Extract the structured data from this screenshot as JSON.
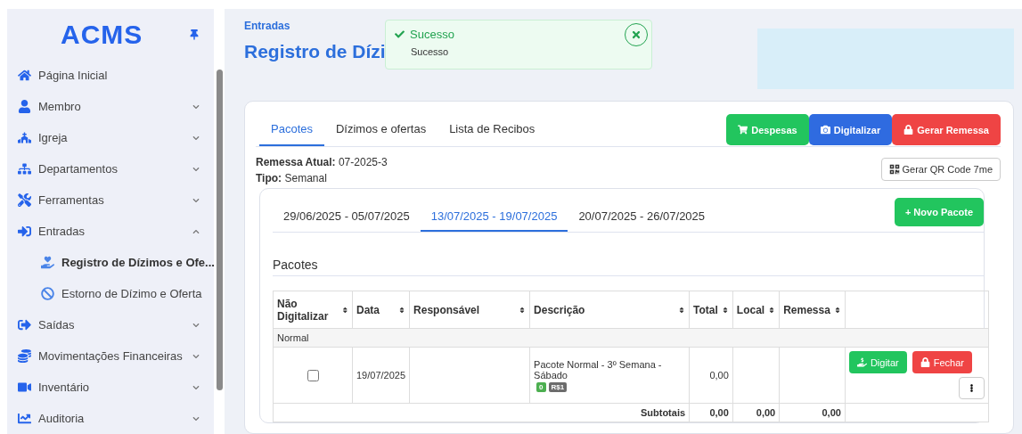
{
  "sidebar": {
    "logo": "ACMS",
    "items": [
      {
        "label": "Página Inicial"
      },
      {
        "label": "Membro",
        "expanded": false
      },
      {
        "label": "Igreja",
        "expanded": false
      },
      {
        "label": "Departamentos",
        "expanded": false
      },
      {
        "label": "Ferramentas",
        "expanded": false
      },
      {
        "label": "Entradas",
        "expanded": true,
        "children": [
          {
            "label": "Registro de Dízimos e Ofe...",
            "selected": true
          },
          {
            "label": "Estorno de Dízimo e Oferta",
            "selected": false
          }
        ]
      },
      {
        "label": "Saídas",
        "expanded": false
      },
      {
        "label": "Movimentações Financeiras",
        "expanded": false
      },
      {
        "label": "Inventário",
        "expanded": false
      },
      {
        "label": "Auditoria",
        "expanded": false
      }
    ]
  },
  "header": {
    "breadcrumb": "Entradas",
    "title": "Registro de Dízi"
  },
  "toast": {
    "title": "Sucesso",
    "message": "Sucesso"
  },
  "tabs": [
    {
      "label": "Pacotes",
      "selected": true
    },
    {
      "label": "Dízimos e ofertas",
      "selected": false
    },
    {
      "label": "Lista de Recibos",
      "selected": false
    }
  ],
  "actions": [
    {
      "label": "Despesas",
      "color": "#22c55e"
    },
    {
      "label": "Digitalizar",
      "color": "#2f6be0"
    },
    {
      "label": "Gerar Remessa",
      "color": "#ef4444"
    }
  ],
  "qr_button": "Gerar QR Code 7me",
  "remessa": {
    "label": "Remessa Atual:",
    "value": "07-2025-3"
  },
  "tipo": {
    "label": "Tipo:",
    "value": "Semanal"
  },
  "weeks": [
    {
      "label": "29/06/2025 - 05/07/2025",
      "selected": false
    },
    {
      "label": "13/07/2025 - 19/07/2025",
      "selected": true
    },
    {
      "label": "20/07/2025 - 26/07/2025",
      "selected": false
    }
  ],
  "new_button": "+ Novo Pacote",
  "section_title": "Pacotes",
  "table": {
    "columns": [
      "Não Digitalizar",
      "Data",
      "Responsável",
      "Descrição",
      "Total",
      "Local",
      "Remessa"
    ],
    "group": "Normal",
    "rows": [
      {
        "checked": false,
        "date": "19/07/2025",
        "description": "Pacote Normal - 3º Semana - Sábado",
        "badges": [
          {
            "label": "0",
            "color": "#4caf50"
          },
          {
            "label": "R$1",
            "color": "#6c6c6c"
          }
        ],
        "total": "0,00",
        "buttons": [
          "Digitar",
          "Fechar"
        ]
      }
    ],
    "subtotal": {
      "label": "Subtotais",
      "values": [
        "0,00",
        "0,00",
        "0,00"
      ]
    }
  }
}
